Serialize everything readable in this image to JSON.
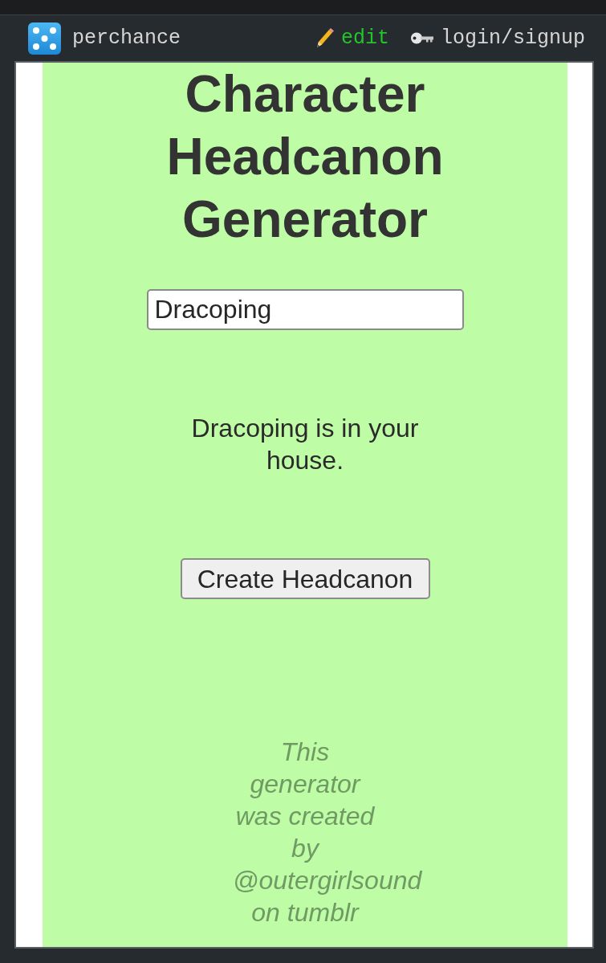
{
  "header": {
    "site_name": "perchance",
    "edit_link": "edit",
    "login_link": "login/signup"
  },
  "generator": {
    "title": "Character Headcanon Generator",
    "name_field": {
      "value": "Dracoping"
    },
    "result": "Dracoping is in your house.",
    "button": "Create Headcanon",
    "credit": "This generator was created by @outergirlsound on tumblr"
  }
}
